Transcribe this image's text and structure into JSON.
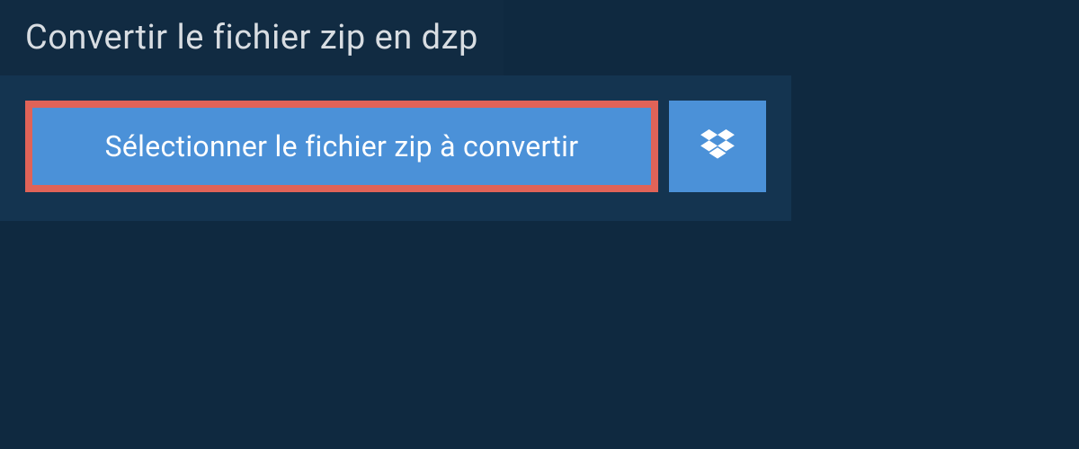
{
  "header": {
    "title": "Convertir le fichier zip en dzp"
  },
  "main": {
    "select_button_label": "Sélectionner le fichier zip à convertir"
  },
  "colors": {
    "background": "#0f2940",
    "header_bg": "#112b42",
    "panel_bg": "#143450",
    "button_bg": "#4b91d8",
    "highlight_border": "#e06358",
    "text_light": "#d8dde2",
    "text_white": "#ffffff"
  }
}
